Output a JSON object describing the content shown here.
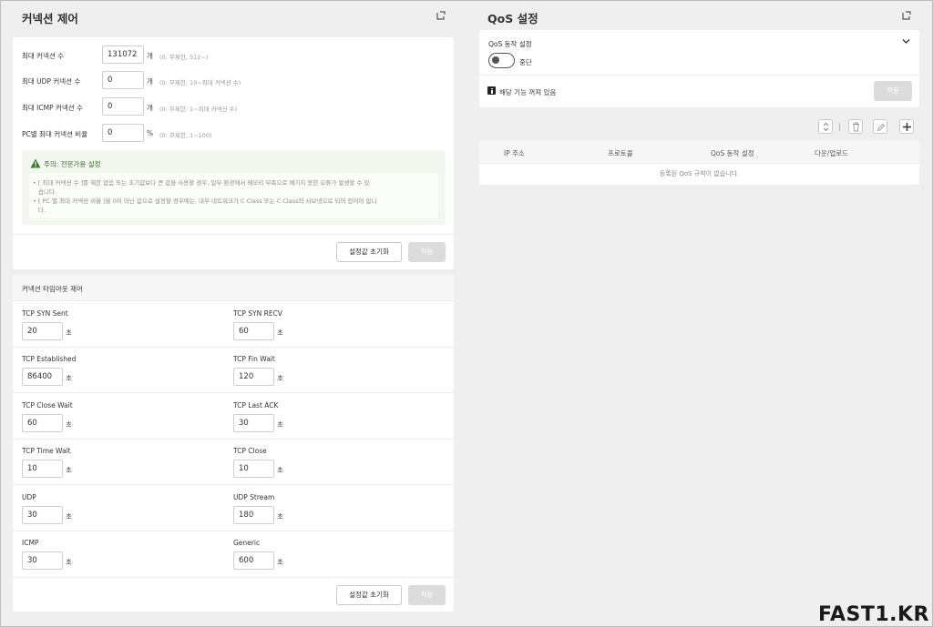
{
  "connection": {
    "title": "커넥션 제어",
    "rows": [
      {
        "label": "최대 커넥션 수",
        "value": "131072",
        "unit": "개",
        "hint": "(0: 무제한, 512~)"
      },
      {
        "label": "최대 UDP 커넥션 수",
        "value": "0",
        "unit": "개",
        "hint": "(0: 무제한, 10~최대 커넥션 수)"
      },
      {
        "label": "최대 ICMP 커넥션 수",
        "value": "0",
        "unit": "개",
        "hint": "(0: 무제한, 1~최대 커넥션 수)"
      },
      {
        "label": "PC별 최대 커넥션 비율",
        "value": "0",
        "unit": "%",
        "hint": "(0: 무제한, 1~100)"
      }
    ],
    "warning": {
      "title": "주의: 전문가용 설정",
      "line1": "• [ 최대 커넥션 수 ]를 제한 없음 또는 초기값보다 큰 값을 사용할 경우, 일부 환경에서 메모리 부족으로 예기치 못한 오류가 발생할 수 있",
      "line1b": "습니다.",
      "line2": "• [ PC 별 최대 커넥션 비율 ]을 0이 아닌 값으로 설정할 경우에는, 내부 네트워크가 C Class 또는 C Class의 서브넷으로 되어 있어야 합니",
      "line2b": "다."
    },
    "reset_label": "설정값 초기화",
    "apply_label": "적용"
  },
  "timeout": {
    "title": "커넥션 타임아웃 제어",
    "unit": "초",
    "items": [
      {
        "label": "TCP SYN Sent",
        "value": "20"
      },
      {
        "label": "TCP SYN RECV",
        "value": "60"
      },
      {
        "label": "TCP Established",
        "value": "86400"
      },
      {
        "label": "TCP Fin Wait",
        "value": "120"
      },
      {
        "label": "TCP Close Wait",
        "value": "60"
      },
      {
        "label": "TCP Last ACK",
        "value": "30"
      },
      {
        "label": "TCP Time Wait",
        "value": "10"
      },
      {
        "label": "TCP Close",
        "value": "10"
      },
      {
        "label": "UDP",
        "value": "30"
      },
      {
        "label": "UDP Stream",
        "value": "180"
      },
      {
        "label": "ICMP",
        "value": "30"
      },
      {
        "label": "Generic",
        "value": "600"
      }
    ],
    "reset_label": "설정값 초기화",
    "apply_label": "적용"
  },
  "qos": {
    "title": "QoS 설정",
    "section_label": "QoS 동작 설정",
    "toggle_label": "중단",
    "toggle_on": false,
    "status_text": "해당 기능 꺼져 있음",
    "apply_label": "적용",
    "table": {
      "headers": [
        "IP 주소",
        "프로토콜",
        "QoS 동작 설정",
        "다운/업로드"
      ],
      "empty_text": "등록된 QoS 규칙이 없습니다."
    }
  },
  "watermark": "FAST1.KR",
  "icons": [
    "refresh-icon",
    "warning-icon",
    "chevron-down-icon",
    "info-icon",
    "sort-icon",
    "trash-icon",
    "edit-icon",
    "plus-icon"
  ]
}
